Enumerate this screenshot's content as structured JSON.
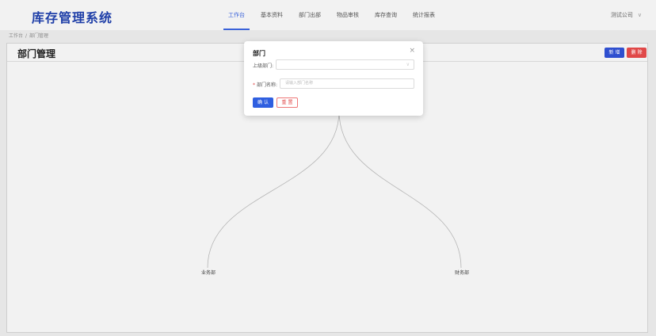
{
  "app": {
    "title": "库存管理系统"
  },
  "nav": {
    "items": [
      {
        "label": "工作台",
        "active": true
      },
      {
        "label": "基本资料",
        "active": false
      },
      {
        "label": "部门出部",
        "active": false
      },
      {
        "label": "物品审核",
        "active": false
      },
      {
        "label": "库存查询",
        "active": false
      },
      {
        "label": "统计报表",
        "active": false
      }
    ],
    "company": "测试公司"
  },
  "breadcrumb": {
    "home": "工作台",
    "separator": "/",
    "current": "部门管理"
  },
  "panel": {
    "title": "部门管理",
    "add_label": "新 增",
    "delete_label": "删 除"
  },
  "tree": {
    "children": [
      "业务部",
      "财务部"
    ]
  },
  "modal": {
    "title": "部门",
    "close_glyph": "×",
    "parent_label": "上级部门:",
    "parent_value": "",
    "name_label": "部门名称:",
    "name_placeholder": "请输入部门名称",
    "confirm_label": "确 认",
    "reset_label": "重 置"
  },
  "colors": {
    "primary": "#2f4fcf",
    "danger": "#e04848",
    "logo": "#1f3fa8"
  }
}
